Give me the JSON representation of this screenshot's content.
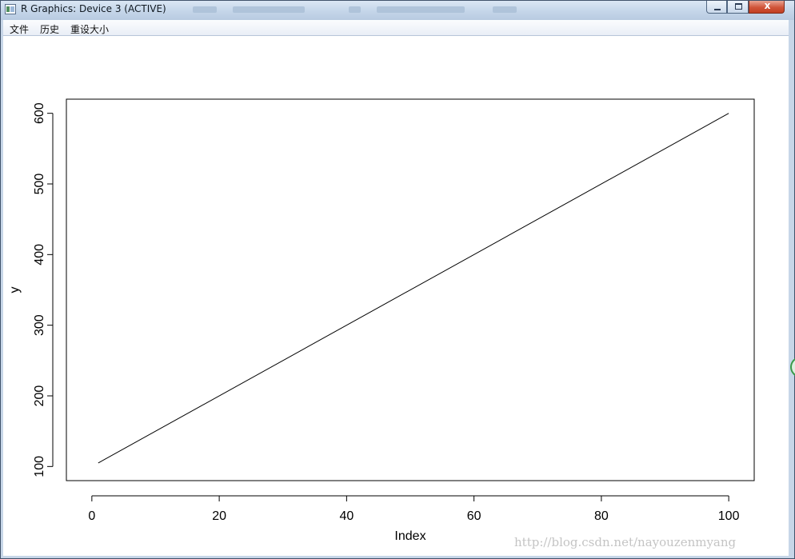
{
  "window": {
    "title": "R Graphics: Device 3 (ACTIVE)",
    "icon": "r-graphics-app-icon",
    "controls": {
      "minimize_icon": "minimize-icon",
      "maximize_icon": "maximize-icon",
      "close_label": "x"
    }
  },
  "menu": {
    "items": [
      {
        "label": "文件"
      },
      {
        "label": "历史"
      },
      {
        "label": "重设大小"
      }
    ]
  },
  "chart_data": {
    "type": "line",
    "title": "",
    "xlabel": "Index",
    "ylabel": "y",
    "xlim": [
      -4,
      104
    ],
    "ylim": [
      80,
      620
    ],
    "xticks": [
      0,
      20,
      40,
      60,
      80,
      100
    ],
    "yticks": [
      100,
      200,
      300,
      400,
      500,
      600
    ],
    "series": [
      {
        "x": [
          1,
          100
        ],
        "y": [
          105,
          600
        ],
        "color": "#000000"
      }
    ],
    "grid": false,
    "legend": "none"
  },
  "watermark": "http://blog.csdn.net/nayouzenmyang"
}
